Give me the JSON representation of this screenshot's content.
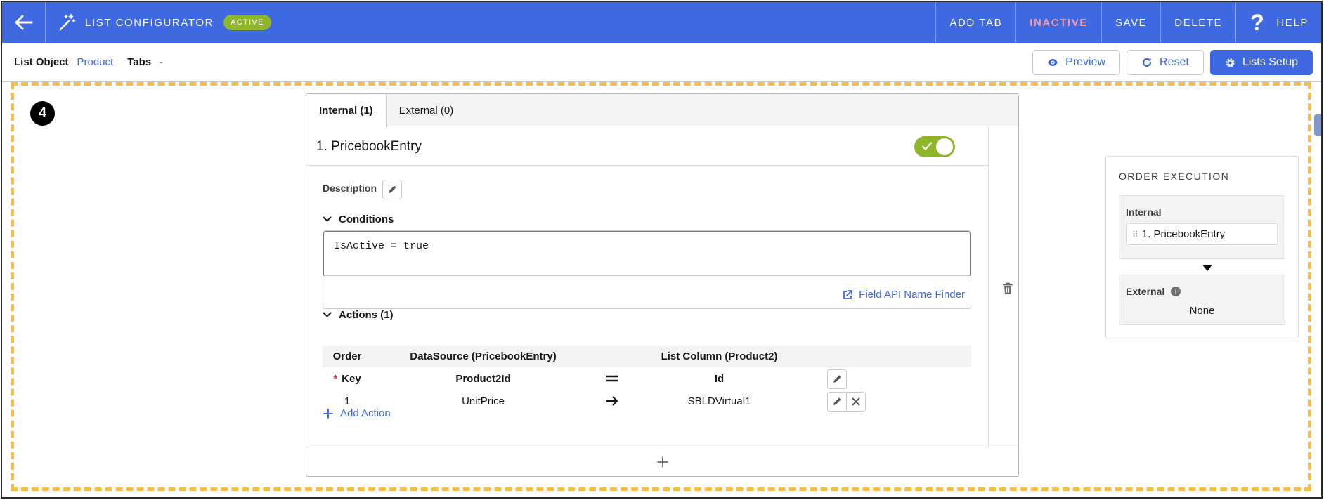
{
  "header": {
    "app_title": "LIST CONFIGURATOR",
    "status_badge": "ACTIVE",
    "actions": {
      "add_tab": "ADD TAB",
      "inactive": "INACTIVE",
      "save": "SAVE",
      "delete": "DELETE",
      "help": "HELP",
      "help_glyph": "?"
    }
  },
  "subheader": {
    "list_object_label": "List Object",
    "list_object_value": "Product",
    "tabs_label": "Tabs",
    "tabs_value": "-",
    "buttons": {
      "preview": "Preview",
      "reset": "Reset",
      "lists_setup": "Lists Setup"
    }
  },
  "step_number": "4",
  "card": {
    "tabs": [
      "Internal (1)",
      "External (0)"
    ],
    "entry_title": "1. PricebookEntry",
    "enabled": true,
    "description_label": "Description",
    "conditions": {
      "label": "Conditions",
      "value": "IsActive = true",
      "finder_link": "Field API Name Finder"
    },
    "actions": {
      "label": "Actions (1)",
      "columns": [
        "Order",
        "DataSource (PricebookEntry)",
        "List Column (Product2)"
      ],
      "rows": [
        {
          "order_required_mark": "*",
          "order": "Key",
          "source": "Product2Id",
          "operator": "=",
          "target": "Id"
        },
        {
          "order": "1",
          "source": "UnitPrice",
          "operator": "→",
          "target": "SBLDVirtual1"
        }
      ],
      "add_label": "Add Action"
    }
  },
  "order_execution": {
    "title": "ORDER EXECUTION",
    "internal_label": "Internal",
    "internal_items": [
      "1. PricebookEntry"
    ],
    "external_label": "External",
    "external_info_glyph": "i",
    "external_value": "None"
  },
  "colors": {
    "header_blue": "#3f69e0",
    "active_green": "#8fb52a",
    "inactive_pink": "#f49aa6",
    "dashed_orange": "#f7bd4b"
  }
}
